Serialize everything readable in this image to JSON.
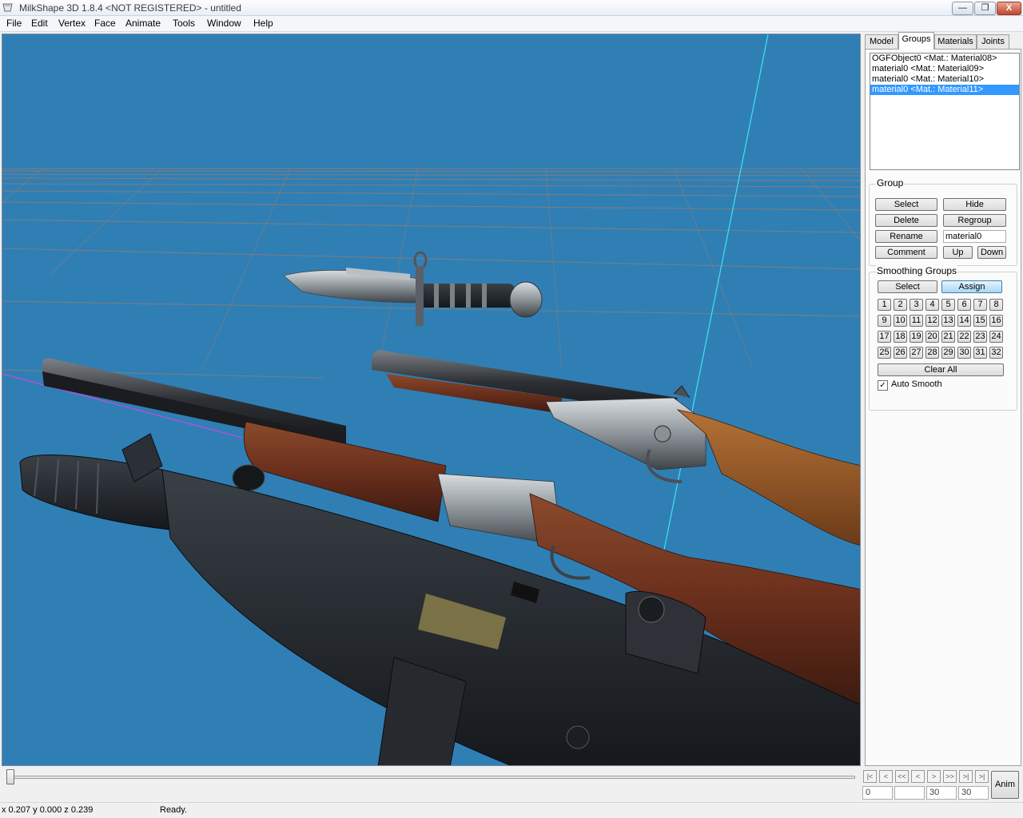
{
  "window": {
    "title": "MilkShape 3D 1.8.4 <NOT REGISTERED> - untitled",
    "minimize": "—",
    "maximize": "❐",
    "close": "X"
  },
  "menu": [
    "File",
    "Edit",
    "Vertex",
    "Face",
    "Animate",
    "Tools",
    "Window",
    "Help"
  ],
  "tabs": [
    "Model",
    "Groups",
    "Materials",
    "Joints"
  ],
  "active_tab": "Groups",
  "groups_list": [
    {
      "label": "OGFObject0 <Mat.: Material08>",
      "selected": false
    },
    {
      "label": "material0 <Mat.: Material09>",
      "selected": false
    },
    {
      "label": "material0 <Mat.: Material10>",
      "selected": false
    },
    {
      "label": "material0 <Mat.: Material11>",
      "selected": true
    }
  ],
  "group_box": {
    "legend": "Group",
    "select": "Select",
    "hide": "Hide",
    "delete": "Delete",
    "regroup": "Regroup",
    "rename": "Rename",
    "name_value": "material0",
    "comment": "Comment",
    "up": "Up",
    "down": "Down"
  },
  "smoothing": {
    "legend": "Smoothing Groups",
    "select": "Select",
    "assign": "Assign",
    "numbers": [
      "1",
      "2",
      "3",
      "4",
      "5",
      "6",
      "7",
      "8",
      "9",
      "10",
      "11",
      "12",
      "13",
      "14",
      "15",
      "16",
      "17",
      "18",
      "19",
      "20",
      "21",
      "22",
      "23",
      "24",
      "25",
      "26",
      "27",
      "28",
      "29",
      "30",
      "31",
      "32"
    ],
    "clear_all": "Clear All",
    "auto_smooth": "Auto Smooth",
    "auto_smooth_checked": true
  },
  "timeline": {
    "nav": [
      "|<",
      "<",
      "<<",
      "<",
      ">",
      ">>",
      ">|",
      ">|"
    ],
    "current_frame": "0",
    "field2": "",
    "field3": "30",
    "field4": "30",
    "anim": "Anim"
  },
  "status": {
    "coords": "x 0.207 y 0.000 z 0.239",
    "message": "Ready."
  },
  "colors": {
    "viewport_bg": "#2f7fb5",
    "selection": "#3399ff",
    "grid": "#c87b4a"
  }
}
